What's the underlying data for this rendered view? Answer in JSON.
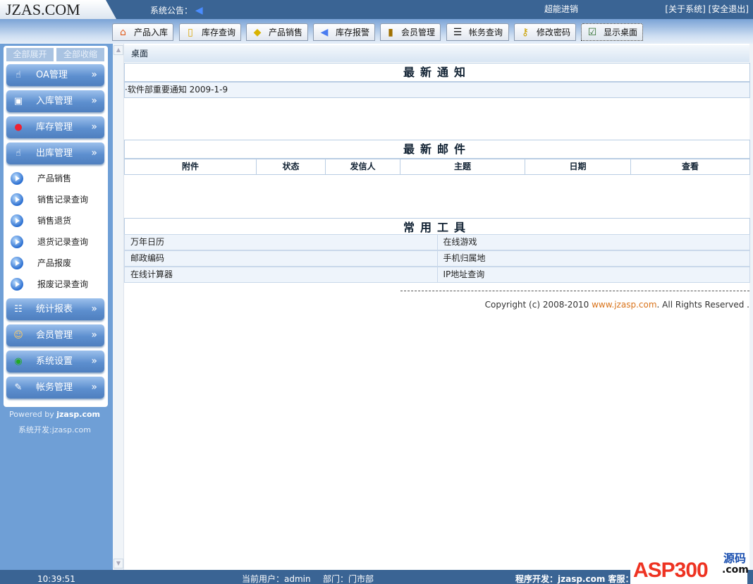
{
  "header": {
    "logo": "JZAS.COM",
    "notice_label": "系统公告：",
    "center_text": "超能进销",
    "about": "[关于系统]",
    "logout": "[安全退出]"
  },
  "toolbar": [
    {
      "label": "产品入库",
      "icon": "house-icon"
    },
    {
      "label": "库存查询",
      "icon": "book-icon"
    },
    {
      "label": "产品销售",
      "icon": "tag-icon"
    },
    {
      "label": "库存报警",
      "icon": "speaker-icon"
    },
    {
      "label": "会员管理",
      "icon": "member-icon"
    },
    {
      "label": "帐务查询",
      "icon": "clipboard-icon"
    },
    {
      "label": "修改密码",
      "icon": "keys-icon"
    },
    {
      "label": "显示桌面",
      "icon": "desktop-icon"
    }
  ],
  "sidebar": {
    "expand_all": "全部展开",
    "collapse_all": "全部收缩",
    "menus_top": [
      {
        "label": "OA管理"
      },
      {
        "label": "入库管理"
      },
      {
        "label": "库存管理"
      },
      {
        "label": "出库管理"
      }
    ],
    "sub_items": [
      "产品销售",
      "销售记录查询",
      "销售退货",
      "退货记录查询",
      "产品报废",
      "报废记录查询"
    ],
    "menus_bottom": [
      {
        "label": "统计报表"
      },
      {
        "label": "会员管理"
      },
      {
        "label": "系统设置"
      },
      {
        "label": "帐务管理"
      }
    ],
    "arrow": "»",
    "powered_prefix": "Powered by ",
    "powered_site": "jzasp.com",
    "dev": "系统开发:jzasp.com"
  },
  "main": {
    "breadcrumb": "桌面",
    "notice_title": "最新通知",
    "notice_item": "·软件部重要通知 2009-1-9",
    "mail_title": "最新邮件",
    "mail_columns": [
      "附件",
      "状态",
      "发信人",
      "主题",
      "日期",
      "查看"
    ],
    "tools_title": "常用工具",
    "tools": [
      [
        "万年日历",
        "在线游戏"
      ],
      [
        "邮政编码",
        "手机归属地"
      ],
      [
        "在线计算器",
        "IP地址查询"
      ]
    ],
    "copyright_prefix": "Copyright (c) 2008-2010 ",
    "copyright_link": "www.jzasp.com",
    "copyright_suffix": ". All Rights Reserved ."
  },
  "footer": {
    "time": "10:39:51",
    "user": "当前用户：admin",
    "dept": "部门：门市部",
    "dev": "程序开发：jzasp.com 客服：",
    "watermark": "ASP300源码 .com"
  }
}
